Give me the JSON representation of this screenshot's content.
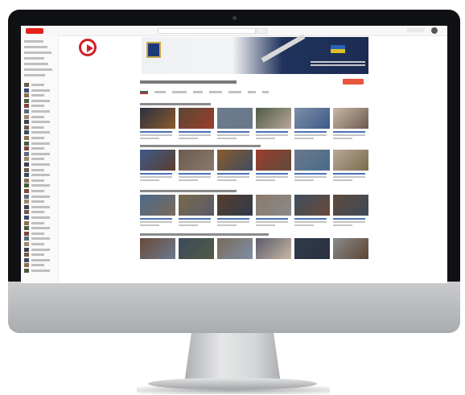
{
  "page": {
    "description_colors": {
      "bezel": "#101114",
      "chin": "#b9bcbf",
      "yt_red": "#e62117"
    }
  },
  "screen": {
    "topbar": {
      "logo_icon": "youtube-logo-icon"
    },
    "overlay_icon": "youtube-play-icon",
    "banner": {
      "flag_icon": "flag-icon",
      "emblem_icon": "emblem-icon"
    },
    "subscribe_color": "#e8543c"
  }
}
